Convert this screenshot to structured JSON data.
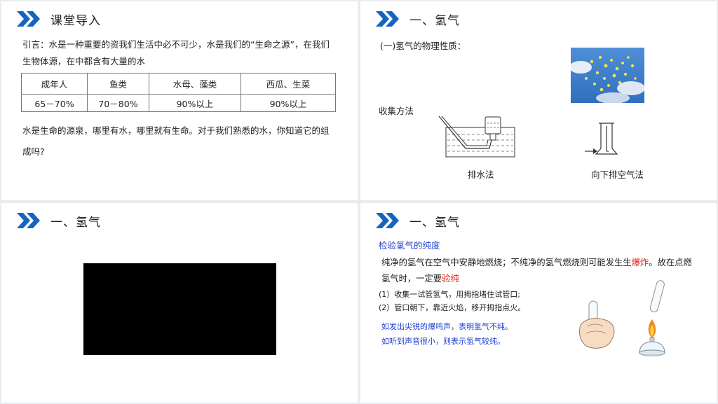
{
  "slide1": {
    "title": "课堂导入",
    "intro_line1": "引言：水是一种重要的资我们生活中必不可少，水是我们的“生命之源”，在我们",
    "intro_line2": "生物体源，在中都含有大量的水",
    "table": {
      "headers": [
        "成年人",
        "鱼类",
        "水母、藻类",
        "西瓜、生菜"
      ],
      "values": [
        "65－70%",
        "70－80%",
        "90%以上",
        "90%以上"
      ]
    },
    "para_line1": "水是生命的源泉，哪里有水，哪里就有生命。对于我们熟悉的水，你知道它的组",
    "para_line2": "成吗?"
  },
  "slide2": {
    "title": "一、氢气",
    "subtitle": "(一)氢气的物理性质：",
    "collect_label": "收集方法",
    "method1": "排水法",
    "method2": "向下排空气法"
  },
  "slide3": {
    "title": "一、氢气"
  },
  "slide4": {
    "title": "一、氢气",
    "heading": "检验氢气的纯度",
    "line1_a": "纯净的氢气在空气中安静地燃烧；不纯净的氢气燃烧则可能发生生",
    "line1_red": "爆炸",
    "line1_b": "。故在点燃",
    "line2_a": "氢气时，一定要",
    "line2_red": "验纯",
    "step1": "(1）收集一试管氢气，用拇指堵住试管口;",
    "step2": "(2）管口朝下，靠近火焰，移开拇指点火。",
    "result1": "如发出尖锐的爆鸣声，表明氢气不纯。",
    "result2": "如听到声音很小，则表示氢气较纯。"
  },
  "colors": {
    "accent_blue": "#1565c0",
    "emphasis_red": "#e02020",
    "note_blue": "#1e3fd0"
  }
}
